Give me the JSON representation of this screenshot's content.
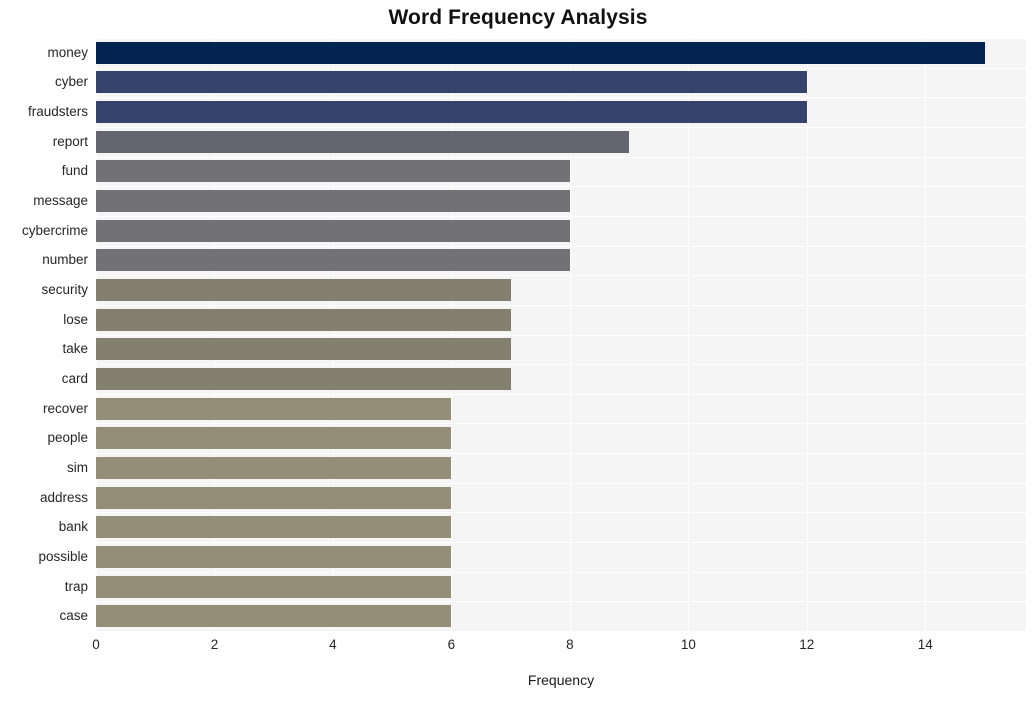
{
  "chart_data": {
    "type": "bar",
    "orientation": "horizontal",
    "title": "Word Frequency Analysis",
    "xlabel": "Frequency",
    "ylabel": "",
    "xlim": [
      0,
      15.7
    ],
    "xticks": [
      0,
      2,
      4,
      6,
      8,
      10,
      12,
      14
    ],
    "xtick_labels": [
      "0",
      "2",
      "4",
      "6",
      "8",
      "10",
      "12",
      "14"
    ],
    "grid": true,
    "grid_color": "#ffffff",
    "plot_background": "#f5f5f6",
    "figure_background": "#ffffff",
    "legend": null,
    "categories": [
      "money",
      "cyber",
      "fraudsters",
      "report",
      "fund",
      "message",
      "cybercrime",
      "number",
      "security",
      "lose",
      "take",
      "card",
      "recover",
      "people",
      "sim",
      "address",
      "bank",
      "possible",
      "trap",
      "case"
    ],
    "values": [
      15,
      12,
      12,
      9,
      8,
      8,
      8,
      8,
      7,
      7,
      7,
      7,
      6,
      6,
      6,
      6,
      6,
      6,
      6,
      6
    ],
    "bar_colors": [
      "#032450",
      "#36436c",
      "#36436c",
      "#64656e",
      "#727276",
      "#727276",
      "#727276",
      "#727276",
      "#83806f",
      "#83806f",
      "#83806f",
      "#83806f",
      "#948d77",
      "#948d77",
      "#948d77",
      "#948d77",
      "#948d77",
      "#948d77",
      "#948d77",
      "#948d77"
    ],
    "bars": [
      {
        "label": "money",
        "value": 15,
        "color": "#032450"
      },
      {
        "label": "cyber",
        "value": 12,
        "color": "#36436c"
      },
      {
        "label": "fraudsters",
        "value": 12,
        "color": "#36436c"
      },
      {
        "label": "report",
        "value": 9,
        "color": "#64656e"
      },
      {
        "label": "fund",
        "value": 8,
        "color": "#727276"
      },
      {
        "label": "message",
        "value": 8,
        "color": "#727276"
      },
      {
        "label": "cybercrime",
        "value": 8,
        "color": "#727276"
      },
      {
        "label": "number",
        "value": 8,
        "color": "#727276"
      },
      {
        "label": "security",
        "value": 7,
        "color": "#83806f"
      },
      {
        "label": "lose",
        "value": 7,
        "color": "#83806f"
      },
      {
        "label": "take",
        "value": 7,
        "color": "#83806f"
      },
      {
        "label": "card",
        "value": 7,
        "color": "#83806f"
      },
      {
        "label": "recover",
        "value": 6,
        "color": "#948d77"
      },
      {
        "label": "people",
        "value": 6,
        "color": "#948d77"
      },
      {
        "label": "sim",
        "value": 6,
        "color": "#948d77"
      },
      {
        "label": "address",
        "value": 6,
        "color": "#948d77"
      },
      {
        "label": "bank",
        "value": 6,
        "color": "#948d77"
      },
      {
        "label": "possible",
        "value": 6,
        "color": "#948d77"
      },
      {
        "label": "trap",
        "value": 6,
        "color": "#948d77"
      },
      {
        "label": "case",
        "value": 6,
        "color": "#948d77"
      }
    ]
  }
}
